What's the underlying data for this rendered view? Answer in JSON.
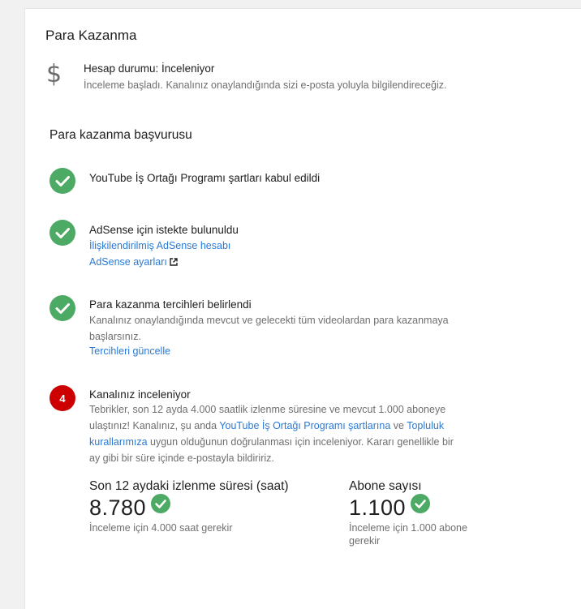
{
  "page": {
    "title": "Para Kazanma"
  },
  "status": {
    "icon": "dollar-icon",
    "title": "Hesap durumu: İnceleniyor",
    "description": "İnceleme başladı. Kanalınız onaylandığında sizi e-posta yoluyla bilgilendireceğiz."
  },
  "application": {
    "title": "Para kazanma başvurusu",
    "steps": [
      {
        "heading": "YouTube İş Ortağı Programı şartları kabul edildi"
      },
      {
        "heading": "AdSense için istekte bulunuldu",
        "link_account": "İlişkilendirilmiş AdSense hesabı",
        "link_settings": "AdSense ayarları"
      },
      {
        "heading": "Para kazanma tercihleri belirlendi",
        "description_1": "Kanalınız onaylandığında mevcut ve gelecekti tüm videolardan para kazanmaya",
        "description_2": "başlarsınız.",
        "link_update": "Tercihleri güncelle"
      },
      {
        "number": "4",
        "heading": "Kanalınız inceleniyor",
        "line1": "Tebrikler, son 12 ayda 4.000 saatlik izlenme süresine ve mevcut 1.000 aboneye",
        "line2_a": "ulaştınız! Kanalınız, şu anda ",
        "line2_link1": "YouTube İş Ortağı Programı şartlarına",
        "line2_b": " ve ",
        "line2_link2": "Topluluk",
        "line3_link": "kurallarımıza",
        "line3_b": " uygun olduğunun doğrulanması için inceleniyor. Kararı genellikle bir",
        "line4": "ay gibi bir süre içinde e-postayla bildiririz."
      }
    ]
  },
  "metrics": {
    "watch_time": {
      "label": "Son 12 aydaki izlenme süresi (saat)",
      "value": "8.780",
      "note": "İnceleme için 4.000 saat gerekir"
    },
    "subscribers": {
      "label": "Abone sayısı",
      "value": "1.100",
      "note_1": "İnceleme için 1.000 abone",
      "note_2": "gerekir"
    }
  },
  "colors": {
    "success": "#4caa64",
    "alert": "#cc0000",
    "link": "#2a7ad5"
  }
}
